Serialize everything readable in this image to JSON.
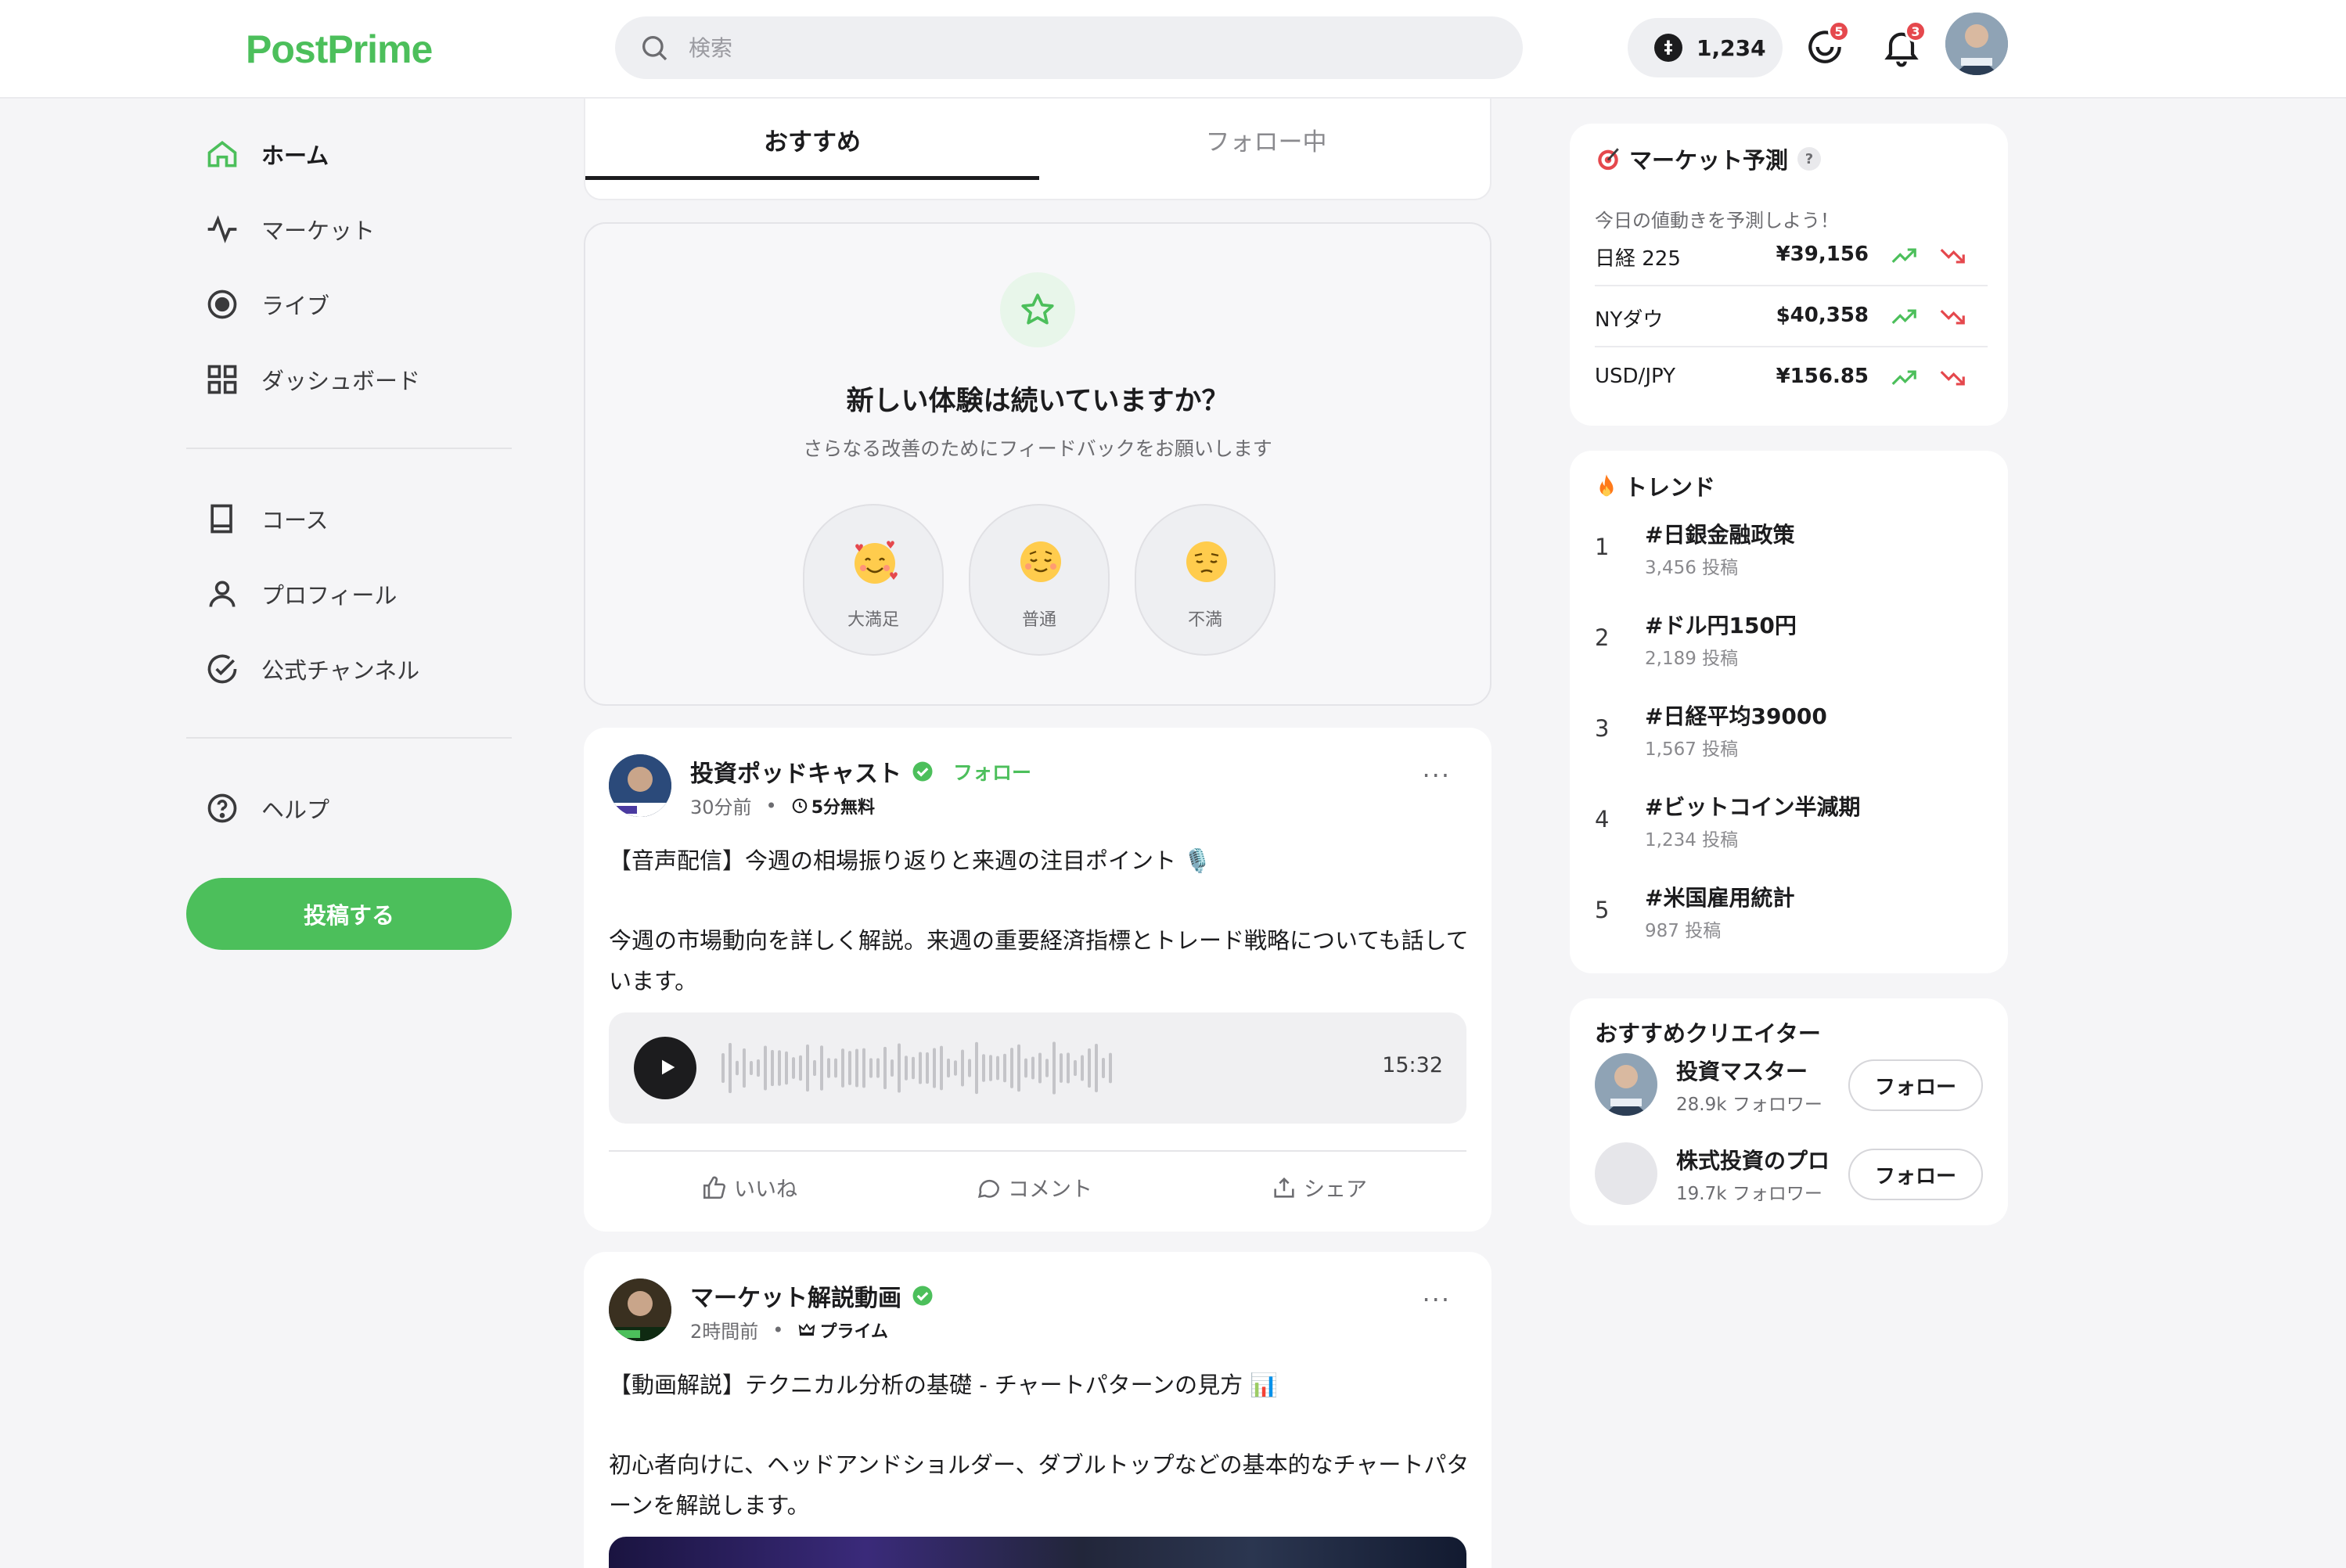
{
  "app": {
    "logo": "PostPrime"
  },
  "header": {
    "search_placeholder": "検索",
    "points": "1,234",
    "coin_symbol": "‡",
    "messages_badge": "5",
    "notifications_badge": "3"
  },
  "sidebar": {
    "items": [
      {
        "label": "ホーム",
        "icon": "home-icon"
      },
      {
        "label": "マーケット",
        "icon": "activity-icon"
      },
      {
        "label": "ライブ",
        "icon": "live-icon"
      },
      {
        "label": "ダッシュボード",
        "icon": "grid-icon"
      },
      {
        "label": "コース",
        "icon": "book-icon"
      },
      {
        "label": "プロフィール",
        "icon": "user-icon"
      },
      {
        "label": "公式チャンネル",
        "icon": "check-circle-icon"
      },
      {
        "label": "ヘルプ",
        "icon": "help-icon"
      }
    ],
    "post_button": "投稿する"
  },
  "tabs": [
    {
      "label": "おすすめ",
      "active": true
    },
    {
      "label": "フォロー中",
      "active": false
    }
  ],
  "feedback": {
    "title": "新しい体験は続いていますか？",
    "subtitle": "さらなる改善のためにフィードバックをお願いします",
    "options": [
      {
        "label": "大満足",
        "emoji": "🥰"
      },
      {
        "label": "普通",
        "emoji": "😌"
      },
      {
        "label": "不満",
        "emoji": "😔"
      }
    ]
  },
  "posts": [
    {
      "author": "投資ポッドキャスト",
      "follow": "フォロー",
      "time": "30分前",
      "tag": "5分無料",
      "title": "【音声配信】今週の相場振り返りと来週の注目ポイント 🎙️",
      "body": "今週の市場動向を詳しく解説。来週の重要経済指標とトレード戦略についても話しています。",
      "duration": "15:32",
      "actions": {
        "like": "いいね",
        "comment": "コメント",
        "share": "シェア"
      }
    },
    {
      "author": "マーケット解説動画",
      "time": "2時間前",
      "tag": "プライム",
      "title": "【動画解説】テクニカル分析の基礎 - チャートパターンの見方 📊",
      "body": "初心者向けに、ヘッドアンドショルダー、ダブルトップなどの基本的なチャートパターンを解説します。"
    }
  ],
  "market": {
    "title": "マーケット予測",
    "help": "?",
    "subtitle": "今日の値動きを予測しよう！",
    "rows": [
      {
        "name": "日経 225",
        "value": "¥39,156"
      },
      {
        "name": "NYダウ",
        "value": "$40,358"
      },
      {
        "name": "USD/JPY",
        "value": "¥156.85"
      }
    ]
  },
  "trends": {
    "title": "トレンド",
    "items": [
      {
        "rank": "1",
        "tag": "#日銀金融政策",
        "count": "3,456 投稿"
      },
      {
        "rank": "2",
        "tag": "#ドル円150円",
        "count": "2,189 投稿"
      },
      {
        "rank": "3",
        "tag": "#日経平均39000",
        "count": "1,567 投稿"
      },
      {
        "rank": "4",
        "tag": "#ビットコイン半減期",
        "count": "1,234 投稿"
      },
      {
        "rank": "5",
        "tag": "#米国雇用統計",
        "count": "987 投稿"
      }
    ]
  },
  "creators": {
    "title": "おすすめクリエイター",
    "items": [
      {
        "name": "投資マスター",
        "followers": "28.9k フォロワー",
        "button": "フォロー"
      },
      {
        "name": "株式投資のプロ",
        "followers": "19.7k フォロワー",
        "button": "フォロー"
      }
    ]
  },
  "colors": {
    "brand": "#4cbf5b",
    "up": "#4cbf5b",
    "down": "#e5484d",
    "badge": "#e5484d"
  }
}
